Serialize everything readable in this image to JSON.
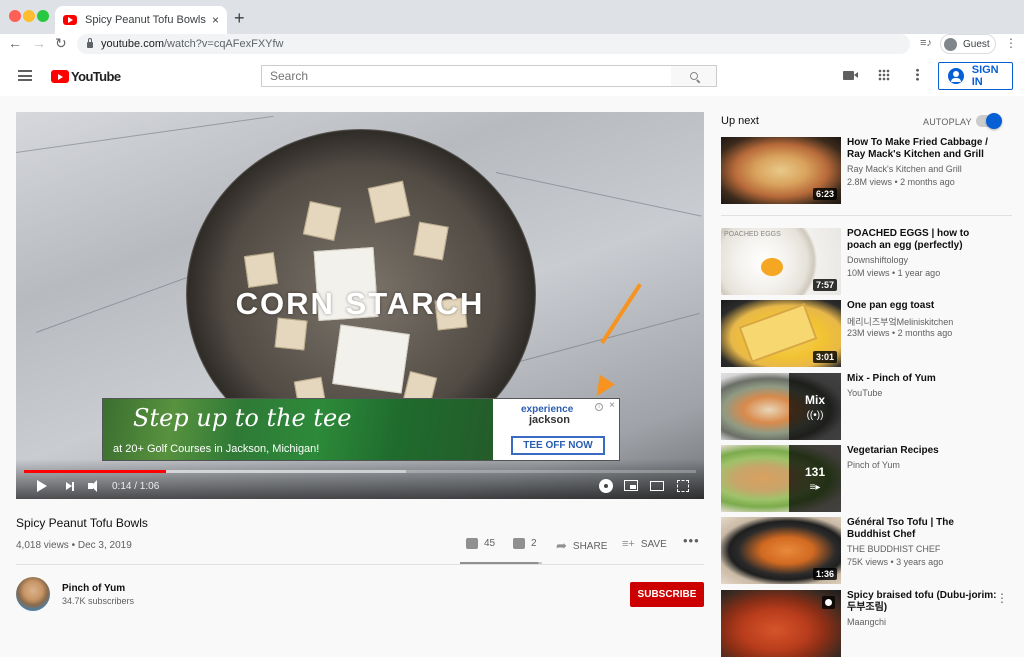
{
  "browser": {
    "tab_title": "Spicy Peanut Tofu Bowls - YouTube",
    "tab_close": "×",
    "new_tab": "+",
    "url_domain": "youtube.com",
    "url_path": "/watch?v=cqAFexFXYfw",
    "profile_label": "Guest",
    "nav_back": "←",
    "nav_forward": "→",
    "nav_reload": "↻",
    "media_icon": "≡♪",
    "menu_icon": "⋮"
  },
  "header": {
    "logo_text": "YouTube",
    "search_placeholder": "Search",
    "signin_label": "SIGN IN"
  },
  "player": {
    "overlay_text": "CORN STARCH",
    "current_time": "0:14",
    "duration": "1:06",
    "time_display": "0:14 / 1:06",
    "played_fraction": 0.212,
    "buffered_fraction": 0.568,
    "ad": {
      "headline": "Step up to the tee",
      "subtext": "at 20+ Golf Courses in Jackson, Michigan!",
      "brand_line1": "experience",
      "brand_line2": "jackson",
      "cta": "TEE OFF NOW",
      "info_icon": "i",
      "close_icon": "×"
    },
    "annotation_color": "#f79321"
  },
  "video": {
    "title": "Spicy Peanut Tofu Bowls",
    "meta": "4,018 views • Dec 3, 2019",
    "likes": "45",
    "dislikes": "2",
    "share_label": "SHARE",
    "save_label": "SAVE",
    "more_label": "•••",
    "like_fraction": 0.957
  },
  "channel": {
    "name": "Pinch of Yum",
    "subscribers": "34.7K subscribers",
    "subscribe_label": "SUBSCRIBE",
    "subscribe_color": "#cc0000"
  },
  "sidebar": {
    "up_next_label": "Up next",
    "autoplay_label": "AUTOPLAY",
    "autoplay_on": true,
    "accent_color": "#065fd4",
    "items": [
      {
        "title": "How To Make Fried Cabbage / Ray Mack's Kitchen and Grill",
        "channel": "Ray Mack's Kitchen and Grill",
        "views": "2.8M views • 2 months ago",
        "duration": "6:23"
      },
      {
        "title": "POACHED EGGS | how to poach an egg (perfectly)",
        "channel": "Downshiftology",
        "views": "10M views • 1 year ago",
        "duration": "7:57",
        "thumb_tag": "POACHED EGGS"
      },
      {
        "title": "One pan egg toast",
        "channel": "메리니즈부엌Meliniskitchen",
        "views": "23M views • 2 months ago",
        "duration": "3:01"
      },
      {
        "title": "Mix - Pinch of Yum",
        "channel": "YouTube",
        "overlay": "Mix",
        "overlay_glyph": "((•))"
      },
      {
        "title": "Vegetarian Recipes",
        "channel": "Pinch of Yum",
        "overlay": "131",
        "overlay_glyph": "≡▸"
      },
      {
        "title": "Général Tso Tofu | The Buddhist Chef",
        "channel": "THE BUDDHIST CHEF",
        "views": "75K views • 3 years ago",
        "duration": "1:36"
      },
      {
        "title": "Spicy braised tofu (Dubu-jorim: 두부조림)",
        "channel": "Maangchi"
      }
    ]
  }
}
